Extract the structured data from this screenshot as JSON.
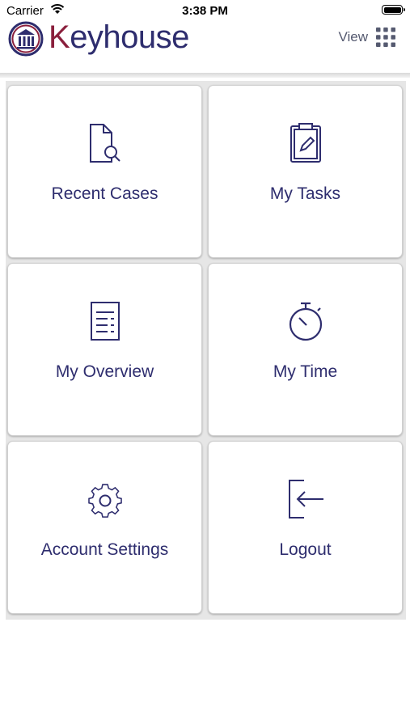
{
  "status_bar": {
    "carrier": "Carrier",
    "time": "3:38 PM"
  },
  "header": {
    "brand_initial": "K",
    "brand_rest": "eyhouse",
    "view_label": "View",
    "view_icon": "grid-icon"
  },
  "colors": {
    "brand_navy": "#2e2d6e",
    "brand_maroon": "#8a1f3c",
    "tile_background": "#ffffff",
    "grid_background": "#e6e6e6"
  },
  "tiles": [
    {
      "label": "Recent Cases",
      "icon": "document-search-icon"
    },
    {
      "label": "My Tasks",
      "icon": "clipboard-pencil-icon"
    },
    {
      "label": "My Overview",
      "icon": "document-list-icon"
    },
    {
      "label": "My Time",
      "icon": "stopwatch-icon"
    },
    {
      "label": "Account Settings",
      "icon": "gear-icon"
    },
    {
      "label": "Logout",
      "icon": "logout-icon"
    }
  ]
}
